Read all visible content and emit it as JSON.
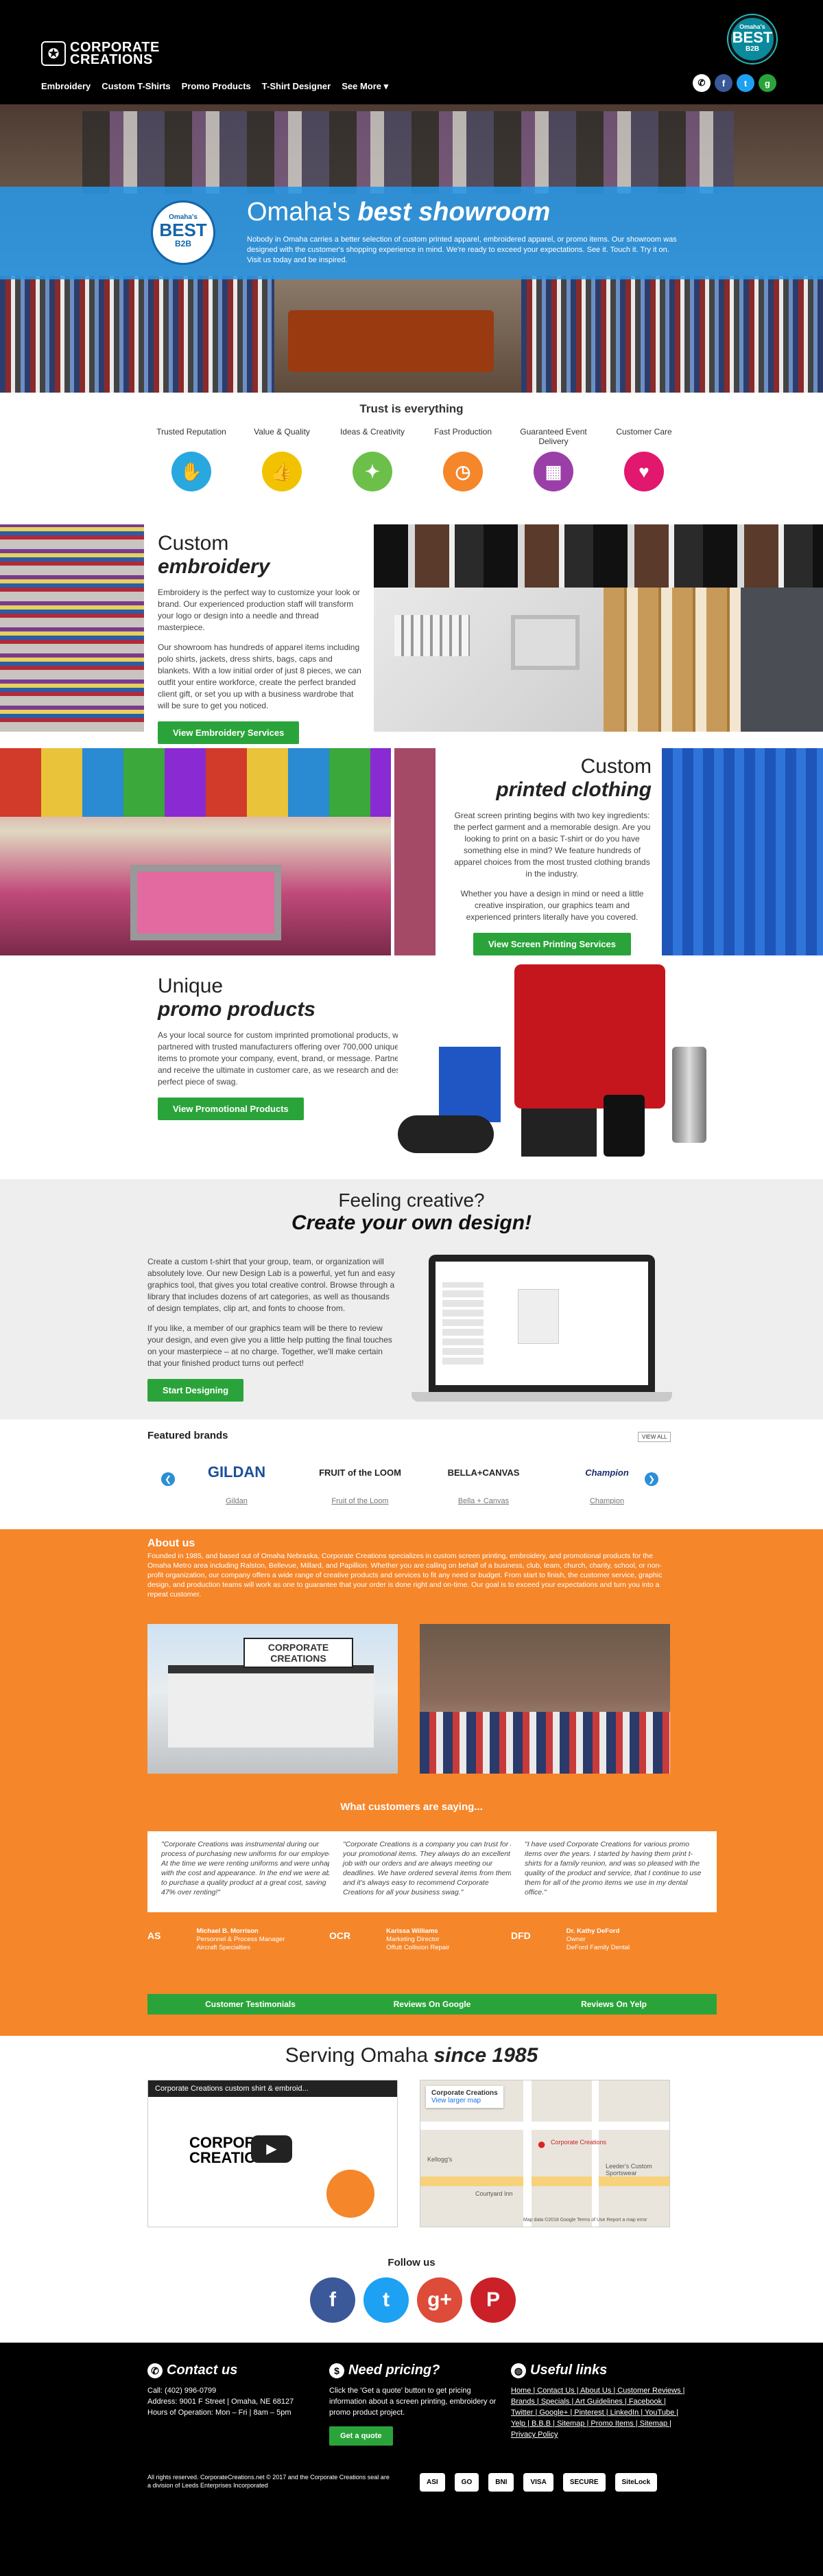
{
  "header": {
    "logo_line1": "CORPORATE",
    "logo_line2": "CREATIONS",
    "nav": [
      "Embroidery",
      "Custom T-Shirts",
      "Promo Products",
      "T-Shirt Designer",
      "See More ▾"
    ],
    "badge": {
      "line1": "Omaha's",
      "line2": "BEST",
      "line3": "B2B"
    },
    "social": [
      {
        "icon": "phone-icon",
        "glyph": "✆",
        "color": "#ffffff"
      },
      {
        "icon": "facebook-icon",
        "glyph": "f",
        "color": "#3b5998"
      },
      {
        "icon": "twitter-icon",
        "glyph": "t",
        "color": "#1da1f2"
      },
      {
        "icon": "google-plus-icon",
        "glyph": "g",
        "color": "#2aa43a"
      }
    ]
  },
  "hero": {
    "title_plain": "Omaha's ",
    "title_emph": "best showroom",
    "badge_line1": "Omaha's",
    "badge_line2": "BEST",
    "badge_line3": "B2B",
    "text": "Nobody in Omaha carries a better selection of custom printed apparel, embroidered apparel, or promo items. Our showroom was designed with the customer's shopping experience in mind. We're ready to exceed your expectations. See it. Touch it. Try it on. Visit us today and be inspired."
  },
  "trust": {
    "title": "Trust is everything",
    "items": [
      {
        "label": "Trusted Reputation",
        "icon": "handshake-icon",
        "glyph": "✋",
        "color": "#29a8e0"
      },
      {
        "label": "Value & Quality",
        "icon": "thumbs-up-icon",
        "glyph": "👍",
        "color": "#f2c200"
      },
      {
        "label": "Ideas & Creativity",
        "icon": "lightbulb-icon",
        "glyph": "✦",
        "color": "#6cc04a"
      },
      {
        "label": "Fast Production",
        "icon": "stopwatch-icon",
        "glyph": "◷",
        "color": "#f5862a"
      },
      {
        "label": "Guaranteed Event Delivery",
        "icon": "calendar-icon",
        "glyph": "▦",
        "color": "#9b3fa8"
      },
      {
        "label": "Customer Care",
        "icon": "heart-icon",
        "glyph": "♥",
        "color": "#e2176e"
      }
    ]
  },
  "embroidery": {
    "title1": "Custom",
    "title2": "embroidery",
    "p1": "Embroidery is the perfect way to customize your look or brand. Our experienced production staff will transform your logo or design into a needle and thread masterpiece.",
    "p2": "Our showroom has hundreds of apparel items including polo shirts, jackets, dress shirts, bags, caps and blankets. With a low initial order of just 8 pieces, we can outfit your entire workforce, create the perfect branded client gift, or set you up with a business wardrobe that will be sure to get you noticed.",
    "button": "View Embroidery Services"
  },
  "printed": {
    "title1": "Custom",
    "title2": "printed clothing",
    "p1": "Great screen printing begins with two key ingredients: the perfect garment and a memorable design. Are you looking to print on a basic T-shirt or do you have something else in mind? We feature hundreds of apparel choices from the most trusted clothing brands in the industry.",
    "p2": "Whether you have a design in mind or need a little creative inspiration, our graphics team and experienced printers literally have you covered.",
    "button": "View Screen Printing Services"
  },
  "promo": {
    "title1": "Unique",
    "title2": "promo products",
    "p1": "As your local source for custom imprinted promotional products, we've partnered with trusted manufacturers offering over 700,000 unique promo items to promote your company, event, brand, or message. Partner with us and receive the ultimate in customer care, as we research and design that perfect piece of swag.",
    "button": "View Promotional Products"
  },
  "designer": {
    "title1": "Feeling creative?",
    "title2": "Create your own design!",
    "p1": "Create a custom t-shirt that your group, team, or organization will absolutely love. Our new Design Lab is a powerful, yet fun and easy graphics tool, that gives you total creative control. Browse through a library that includes dozens of art categories, as well as thousands of design templates, clip art, and fonts to choose from.",
    "p2": "If you like, a member of our graphics team will be there to review your design, and even give you a little help putting the final touches on your masterpiece – at no charge. Together, we'll make certain that your finished product turns out perfect!",
    "button": "Start Designing"
  },
  "brands": {
    "title": "Featured brands",
    "view_all": "VIEW ALL",
    "items": [
      {
        "logo": "GILDAN",
        "name": "Gildan",
        "color": "#1b4f9a"
      },
      {
        "logo": "FRUIT of the LOOM",
        "name": "Fruit of the Loom",
        "color": "#222222"
      },
      {
        "logo": "BELLA+CANVAS",
        "name": "Bella + Canvas",
        "color": "#222222"
      },
      {
        "logo": "Champion",
        "name": "Champion",
        "color": "#1b2f6a"
      }
    ]
  },
  "about": {
    "title": "About us",
    "text": "Founded in 1985, and based out of Omaha Nebraska, Corporate Creations specializes in custom screen printing, embroidery, and promotional products for the Omaha Metro area including Ralston, Bellevue, Millard, and Papillion. Whether you are calling on behalf of a business, club, team, church, charity, school, or non-profit organization, our company offers a wide range of creative products and services to fit any need or budget. From start to finish, the customer service, graphic design, and production teams will work as one to guarantee that your order is done right and on-time. Our goal is to exceed your expectations and turn you into a repeat customer.",
    "storefront_sign": "CORPORATE CREATIONS",
    "testimonials_title": "What customers are saying...",
    "quotes": [
      {
        "text": "\"Corporate Creations was instrumental during our process of purchasing new uniforms for our employees. At the time we were renting uniforms and were unhappy with the cost and appearance. In the end we were able to purchase a quality product at a great cost, saving 47% over renting!\"",
        "name": "Michael B. Morrison",
        "role": "Personnel & Process Manager",
        "org": "Aircraft Specialties",
        "logo": "AS"
      },
      {
        "text": "\"Corporate Creations is a company you can trust for all your promotional items. They always do an excellent job with our orders and are always meeting our deadlines. We have ordered several items from them and it's always easy to recommend Corporate Creations for all your business swag.\"",
        "name": "Karissa Williams",
        "role": "Marketing Director",
        "org": "Offutt Collision Repair",
        "logo": "OCR"
      },
      {
        "text": "\"I have used Corporate Creations for various promo items over the years. I started by having them print t-shirts for a family reunion, and was so pleased with the quality of the product and service, that I continue to use them for all of the promo items we use in my dental office.\"",
        "name": "Dr. Kathy DeFord",
        "role": "Owner",
        "org": "DeFord Family Dental",
        "logo": "DFD"
      }
    ],
    "buttons": [
      "Customer Testimonials",
      "Reviews On Google",
      "Reviews On Yelp"
    ]
  },
  "serving": {
    "title_plain": "Serving Omaha ",
    "title_emph": "since 1985",
    "video_title": "Corporate Creations custom shirt & embroid...",
    "video_logo": "CORPORATE CREATIONS",
    "map_title": "Corporate Creations",
    "map_link": "View larger map",
    "map_pin": "Corporate Creations",
    "map_labels": [
      "Kellogg's",
      "Courtyard Inn",
      "Leeder's Custom Sportswear"
    ],
    "map_footer": "Map data ©2018 Google   Terms of Use   Report a map error"
  },
  "follow": {
    "title": "Follow us",
    "icons": [
      {
        "icon": "facebook-icon",
        "glyph": "f",
        "color": "#3b5998"
      },
      {
        "icon": "twitter-icon",
        "glyph": "t",
        "color": "#1da1f2"
      },
      {
        "icon": "google-plus-icon",
        "glyph": "g+",
        "color": "#dd4b39"
      },
      {
        "icon": "pinterest-icon",
        "glyph": "P",
        "color": "#cb2027"
      }
    ]
  },
  "footer": {
    "contact_title": "Contact us",
    "call": "Call: (402) 996-0799",
    "address": "Address: 9001 F Street | Omaha, NE 68127",
    "hours": "Hours of Operation: Mon – Fri | 8am – 5pm",
    "pricing_title": "Need pricing?",
    "pricing_text": "Click the 'Get a quote' button to get pricing information about a screen printing, embroidery or promo product project.",
    "quote_button": "Get a quote",
    "links_title": "Useful links",
    "links": "Home | Contact Us | About Us | Customer Reviews | Brands | Specials | Art Guidelines | Facebook | Twitter | Google+ | Pinterest | LinkedIn | YouTube | Yelp | B.B.B | Sitemap | Promo Items | Sitemap | Privacy Policy",
    "copyright": "All rights reserved. CorporateCreations.net © 2017 and the Corporate Creations seal are a division of Leeds Enterprises Incorporated",
    "badges": [
      "ASI",
      "GO",
      "BNI",
      "VISA",
      "SECURE",
      "SiteLock"
    ]
  }
}
